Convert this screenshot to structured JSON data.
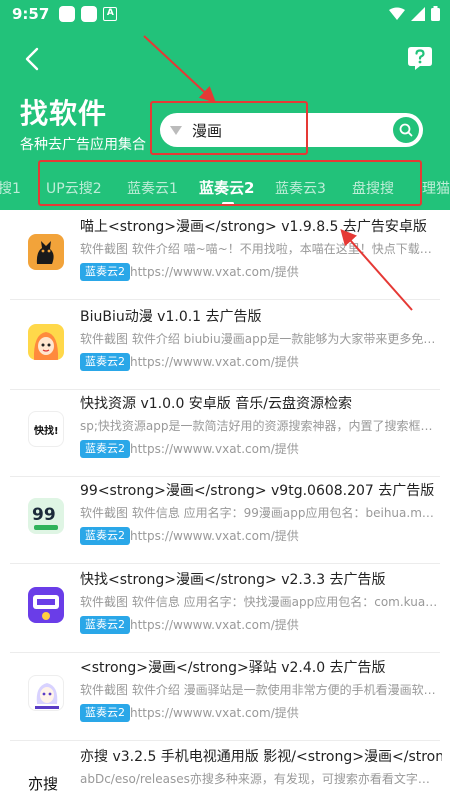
{
  "status": {
    "time": "9:57"
  },
  "header": {
    "title": "找软件",
    "subtitle": "各种去广告应用集合"
  },
  "search": {
    "value": "漫画"
  },
  "tabs": [
    {
      "label": "搜1"
    },
    {
      "label": "UP云搜2"
    },
    {
      "label": "蓝奏云1"
    },
    {
      "label": "蓝奏云2",
      "active": true
    },
    {
      "label": "蓝奏云3"
    },
    {
      "label": "盘搜搜"
    },
    {
      "label": "理猫"
    }
  ],
  "colors": {
    "header_green": "#22c27a",
    "tag_blue": "#2aa7e8",
    "annotation_red": "#e53935"
  },
  "items": [
    {
      "title": "喵上<strong>漫画</strong> v1.9.8.5 去广告安卓版",
      "desc": "软件截图 软件介绍 喵~喵~！不用找啦，本喵在这里！快点下载《…",
      "tag": "蓝奏云2",
      "link": "https://wwww.vxat.com/提供",
      "icon": "black-cat-app-icon"
    },
    {
      "title": "BiuBiu动漫 v1.0.1 去广告版",
      "desc": "软件截图 软件介绍 biubiu漫画app是一款能够为大家带来更多免费…",
      "tag": "蓝奏云2",
      "link": "https://wwww.vxat.com/提供",
      "icon": "anime-girl-app-icon"
    },
    {
      "title": "快找资源 v1.0.0 安卓版 音乐/云盘资源检索",
      "desc": "sp;快找资源app是一款简洁好用的资源搜索神器，内置了搜索框，…",
      "tag": "蓝奏云2",
      "link": "https://wwww.vxat.com/提供",
      "icon": "kuaizhao-app-icon"
    },
    {
      "title": "99<strong>漫画</strong> v9tg.0608.207 去广告版",
      "desc": "软件截图 软件信息 应用名字：99漫画app应用包名：beihua.mfzm…",
      "tag": "蓝奏云2",
      "link": "https://wwww.vxat.com/提供",
      "icon": "99-manhua-app-icon"
    },
    {
      "title": "快找<strong>漫画</strong> v2.3.3 去广告版",
      "desc": "软件截图 软件信息 应用名字：快找漫画app应用包名：com.kuaizh…",
      "tag": "蓝奏云2",
      "link": "https://wwww.vxat.com/提供",
      "icon": "kuaizhao-manhua-app-icon"
    },
    {
      "title": "<strong>漫画</strong>驿站 v2.4.0 去广告版",
      "desc": "软件截图 软件介绍 漫画驿站是一款使用非常方便的手机看漫画软…",
      "tag": "蓝奏云2",
      "link": "https://wwww.vxat.com/提供",
      "icon": "manhua-yizhan-app-icon"
    },
    {
      "title": "亦搜 v3.2.5 手机电视通用版 影视/<strong>漫画</strong>/",
      "desc": "abDc/eso/releases亦搜多种来源，有发现，可搜索亦看看文字，…",
      "tag": "",
      "link": "",
      "icon": "yisou-app-icon"
    }
  ]
}
